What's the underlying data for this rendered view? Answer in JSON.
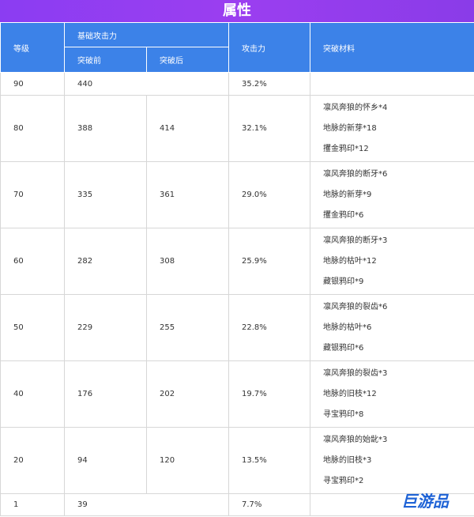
{
  "title": "属性",
  "headers": {
    "level": "等级",
    "base_attack": "基础攻击力",
    "before_breakthrough": "突破前",
    "after_breakthrough": "突破后",
    "attack": "攻击力",
    "materials": "突破材料"
  },
  "rows": [
    {
      "level": "90",
      "before": "440",
      "after": "",
      "attack": "35.2%",
      "materials": []
    },
    {
      "level": "80",
      "before": "388",
      "after": "414",
      "attack": "32.1%",
      "materials": [
        "凛风奔狼的怀乡*4",
        "地脉的新芽*18",
        "攫金鸦印*12"
      ]
    },
    {
      "level": "70",
      "before": "335",
      "after": "361",
      "attack": "29.0%",
      "materials": [
        "凛风奔狼的断牙*6",
        "地脉的新芽*9",
        "攫金鸦印*6"
      ]
    },
    {
      "level": "60",
      "before": "282",
      "after": "308",
      "attack": "25.9%",
      "materials": [
        "凛风奔狼的断牙*3",
        "地脉的枯叶*12",
        "藏银鸦印*9"
      ]
    },
    {
      "level": "50",
      "before": "229",
      "after": "255",
      "attack": "22.8%",
      "materials": [
        "凛风奔狼的裂齿*6",
        "地脉的枯叶*6",
        "藏银鸦印*6"
      ]
    },
    {
      "level": "40",
      "before": "176",
      "after": "202",
      "attack": "19.7%",
      "materials": [
        "凛风奔狼的裂齿*3",
        "地脉的旧枝*12",
        "寻宝鸦印*8"
      ]
    },
    {
      "level": "20",
      "before": "94",
      "after": "120",
      "attack": "13.5%",
      "materials": [
        "凛风奔狼的始龀*3",
        "地脉的旧枝*3",
        "寻宝鸦印*2"
      ]
    },
    {
      "level": "1",
      "before": "39",
      "after": "",
      "attack": "7.7%",
      "materials": []
    }
  ],
  "watermark": "巨游品",
  "colors": {
    "title_bg": "#9b3ef0",
    "header_bg": "#3c82e8",
    "watermark": "#1f63d6"
  }
}
